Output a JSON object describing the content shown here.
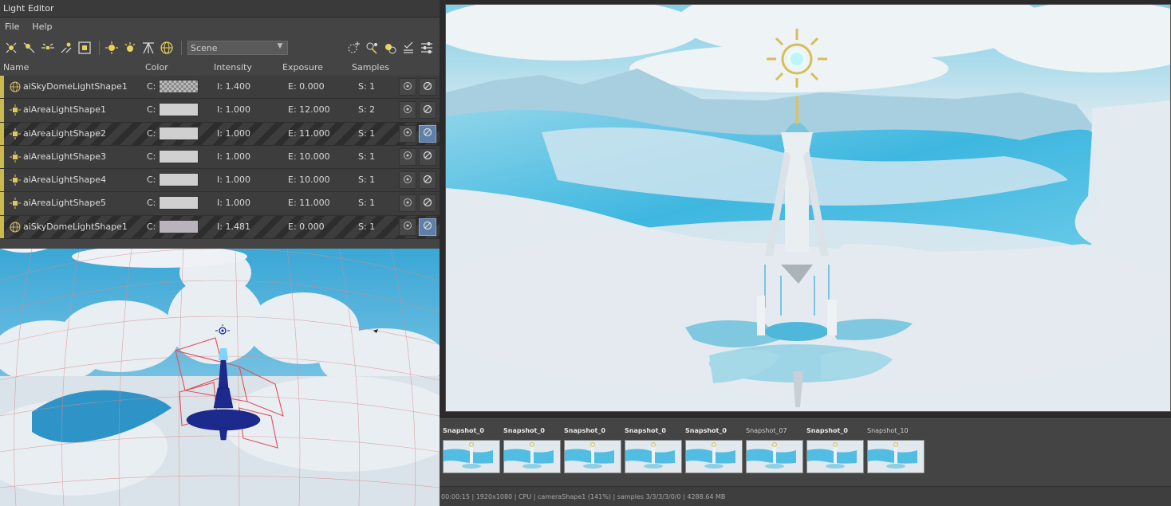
{
  "window": {
    "title": "Light Editor"
  },
  "menu": {
    "items": [
      "File",
      "Help"
    ]
  },
  "toolbar": {
    "scene_select": {
      "value": "Scene"
    }
  },
  "columns": [
    "Name",
    "Color",
    "Intensity",
    "Exposure",
    "Samples"
  ],
  "lights": [
    {
      "name": "aiSkyDomeLightShape1",
      "icon": "skydome-icon",
      "c_prefix": "C:",
      "swatch": "checker",
      "intensity": "I:  1.400",
      "exposure": "E:  0.000",
      "samples": "S:  1",
      "striped": false,
      "disabled_on": false
    },
    {
      "name": "aiAreaLightShape1",
      "icon": "area-light-icon",
      "c_prefix": "C:",
      "swatch": "plain",
      "intensity": "I:  1.000",
      "exposure": "E:  12.000",
      "samples": "S:  2",
      "striped": false,
      "disabled_on": false
    },
    {
      "name": "aiAreaLightShape2",
      "icon": "area-light-icon",
      "c_prefix": "C:",
      "swatch": "plain",
      "intensity": "I:  1.000",
      "exposure": "E:  11.000",
      "samples": "S:  1",
      "striped": true,
      "disabled_on": true
    },
    {
      "name": "aiAreaLightShape3",
      "icon": "area-light-icon",
      "c_prefix": "C:",
      "swatch": "plain",
      "intensity": "I:  1.000",
      "exposure": "E:  10.000",
      "samples": "S:  1",
      "striped": false,
      "disabled_on": false
    },
    {
      "name": "aiAreaLightShape4",
      "icon": "area-light-icon",
      "c_prefix": "C:",
      "swatch": "plain",
      "intensity": "I:  1.000",
      "exposure": "E:  10.000",
      "samples": "S:  1",
      "striped": false,
      "disabled_on": false
    },
    {
      "name": "aiAreaLightShape5",
      "icon": "area-light-icon",
      "c_prefix": "C:",
      "swatch": "plain",
      "intensity": "I:  1.000",
      "exposure": "E:  11.000",
      "samples": "S:  1",
      "striped": false,
      "disabled_on": false
    },
    {
      "name": "aiSkyDomeLightShape1",
      "icon": "skydome-icon",
      "c_prefix": "C:",
      "swatch": "dim",
      "intensity": "I:  1.481",
      "exposure": "E:  0.000",
      "samples": "S:  1",
      "striped": true,
      "disabled_on": true
    }
  ],
  "snapshots": [
    {
      "label": "Snapshot_0",
      "bold": true
    },
    {
      "label": "Snapshot_0",
      "bold": true
    },
    {
      "label": "Snapshot_0",
      "bold": true
    },
    {
      "label": "Snapshot_0",
      "bold": true
    },
    {
      "label": "Snapshot_0",
      "bold": true
    },
    {
      "label": "Snapshot_07",
      "bold": false
    },
    {
      "label": "Snapshot_0",
      "bold": true
    },
    {
      "label": "Snapshot_10",
      "bold": false
    }
  ],
  "status": {
    "text": "00:00:15 | 1920x1080 | CPU | cameraShape1 (141%) | samples 3/3/3/3/0/0 | 4288.64 MB"
  },
  "colors": {
    "accent": "#c9b94e",
    "toggle_on": "#5d7fa8",
    "panel": "#444444"
  }
}
